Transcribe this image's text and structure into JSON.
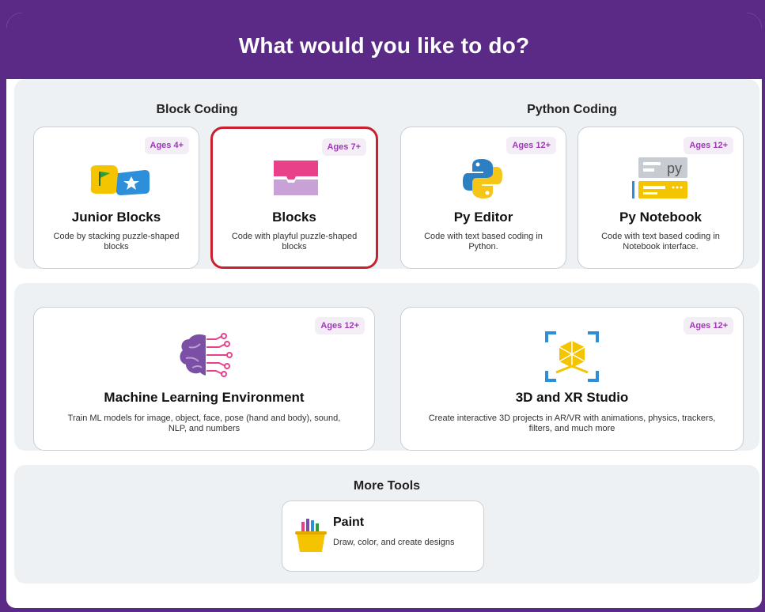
{
  "header": {
    "title": "What would you like to do?"
  },
  "block_coding": {
    "title": "Block Coding"
  },
  "python_coding": {
    "title": "Python Coding"
  },
  "cards": {
    "junior": {
      "title": "Junior Blocks",
      "desc": "Code by stacking puzzle-shaped blocks",
      "age": "Ages 4+",
      "icon": "junior-blocks-icon"
    },
    "blocks": {
      "title": "Blocks",
      "desc": "Code with playful puzzle-shaped blocks",
      "age": "Ages 7+",
      "icon": "blocks-icon"
    },
    "pyeditor": {
      "title": "Py Editor",
      "desc": "Code with text based coding in Python.",
      "age": "Ages 12+",
      "icon": "python-icon"
    },
    "pynotebook": {
      "title": "Py Notebook",
      "desc": "Code with text based coding in Notebook interface.",
      "age": "Ages 12+",
      "icon": "notebook-icon"
    },
    "ml": {
      "title": "Machine Learning Environment",
      "desc": "Train ML models for image, object, face, pose (hand and body), sound, NLP, and numbers",
      "age": "Ages 12+",
      "icon": "brain-icon"
    },
    "xr": {
      "title": "3D and XR Studio",
      "desc": "Create interactive 3D projects in AR/VR with animations, physics, trackers, filters, and much more",
      "age": "Ages 12+",
      "icon": "cube-icon"
    }
  },
  "more_tools": {
    "title": "More Tools",
    "paint": {
      "title": "Paint",
      "desc": "Draw, color, and create designs",
      "icon": "paint-bucket-icon"
    }
  },
  "colors": {
    "brand_purple": "#5b2a86",
    "badge_text": "#9b3db0",
    "selected_border": "#c8202f"
  }
}
